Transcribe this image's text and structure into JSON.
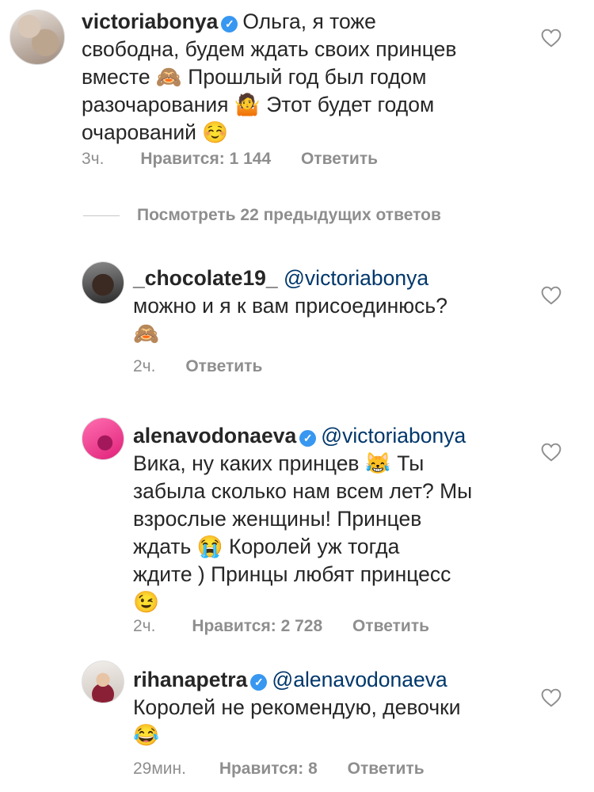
{
  "comments": [
    {
      "username": "victoriabonya",
      "verified": true,
      "lines": [
        "Ольга, я тоже",
        "свободна, будем ждать своих принцев",
        "вместе 🙈 Прошлый год был годом",
        "разочарования 🤷 Этот будет годом",
        "очарований ☺️"
      ],
      "time": "3ч.",
      "likes": "Нравится: 1 144",
      "reply": "Ответить"
    },
    {
      "username": "_chocolate19_",
      "verified": false,
      "mention": "@victoriabonya",
      "lines": [
        "можно и я к вам присоединюсь?",
        "🙈"
      ],
      "time": "2ч.",
      "reply": "Ответить"
    },
    {
      "username": "alenavodonaeva",
      "verified": true,
      "mention": "@victoriabonya",
      "lines": [
        "Вика, ну каких принцев 😹 Ты",
        "забыла сколько нам всем лет? Мы",
        "взрослые женщины! Принцев",
        "ждать 😭 Королей уж тогда",
        "ждите ) Принцы любят принцесс",
        "😉"
      ],
      "time": "2ч.",
      "likes": "Нравится: 2 728",
      "reply": "Ответить"
    },
    {
      "username": "rihanapetra",
      "verified": true,
      "mention": "@alenavodonaeva",
      "lines": [
        "Королей не рекомендую, девочки",
        "😂"
      ],
      "time": "29мин.",
      "likes": "Нравится: 8",
      "reply": "Ответить"
    }
  ],
  "view_replies": "Посмотреть 22 предыдущих ответов",
  "icons": {
    "like": "heart-outline-icon",
    "verified": "verified-badge-icon"
  },
  "colors": {
    "text": "#262626",
    "meta": "#8e8e8e",
    "mention": "#00376b",
    "verified": "#3897f0"
  }
}
